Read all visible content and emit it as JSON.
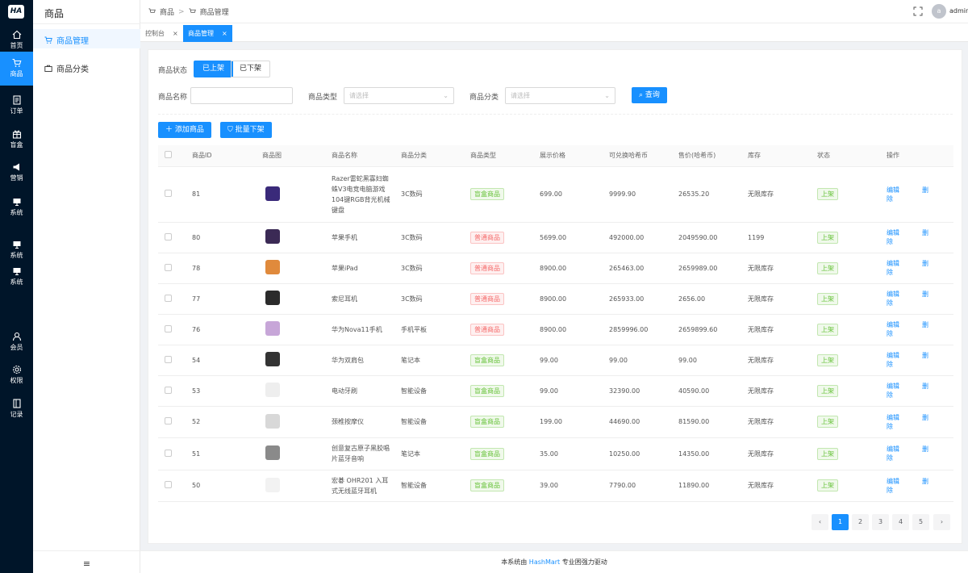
{
  "app": {
    "logo_text": "HA"
  },
  "rail": [
    {
      "label": "首页",
      "icon": "home-icon"
    },
    {
      "label": "商品",
      "icon": "cart-icon",
      "active": true
    },
    {
      "label": "订单",
      "icon": "document-icon"
    },
    {
      "label": "盲盒",
      "icon": "gift-icon"
    },
    {
      "label": "营销",
      "icon": "megaphone-icon"
    },
    {
      "label": "系统",
      "icon": "monitor-icon"
    },
    {
      "label": "系统",
      "icon": "monitor-icon"
    },
    {
      "label": "系统",
      "icon": "monitor-icon"
    },
    {
      "label": "会员",
      "icon": "user-icon"
    },
    {
      "label": "权限",
      "icon": "settings-icon"
    },
    {
      "label": "记录",
      "icon": "record-icon"
    }
  ],
  "sidebar": {
    "title": "商品",
    "items": [
      {
        "label": "商品管理",
        "icon": "cart-icon",
        "active": true
      },
      {
        "label": "商品分类",
        "icon": "briefcase-icon"
      }
    ],
    "collapse_glyph": "≡"
  },
  "header": {
    "breadcrumb": [
      "商品",
      "商品管理"
    ],
    "user": {
      "avatar_letter": "a",
      "name": "admin"
    }
  },
  "tabs": [
    {
      "label": "控制台",
      "close": "×"
    },
    {
      "label": "商品管理",
      "close": "×",
      "active": true
    }
  ],
  "filters": {
    "status_label": "商品状态",
    "status_options": [
      "已上架",
      "已下架"
    ],
    "name_label": "商品名称",
    "type_label": "商品类型",
    "type_placeholder": "请选择",
    "category_label": "商品分类",
    "category_placeholder": "请选择",
    "query_button": "查询"
  },
  "actions": {
    "add": "添加商品",
    "batch_off": "批量下架"
  },
  "table": {
    "headers": [
      "商品ID",
      "商品图",
      "商品名称",
      "商品分类",
      "商品类型",
      "展示价格",
      "可兑换哈希币",
      "售价(哈希币)",
      "库存",
      "状态",
      "操作"
    ],
    "edit_label": "编辑",
    "delete_label": "删除",
    "rows": [
      {
        "id": "81",
        "name": "Razer雷蛇黑寡妇蜘蛛V3电竞电脑游戏104键RGB背光机械键盘",
        "category": "3C数码",
        "type": "盲盒商品",
        "type_kind": "blind",
        "price": "699.00",
        "coins": "9999.90",
        "sale": "26535.20",
        "stock": "无限库存",
        "status": "上架",
        "img_color": "#3a2a7a"
      },
      {
        "id": "80",
        "name": "苹果手机",
        "category": "3C数码",
        "type": "普通商品",
        "type_kind": "normal",
        "price": "5699.00",
        "coins": "492000.00",
        "sale": "2049590.00",
        "stock": "1199",
        "status": "上架",
        "img_color": "#3b2a55"
      },
      {
        "id": "78",
        "name": "苹果iPad",
        "category": "3C数码",
        "type": "普通商品",
        "type_kind": "normal",
        "price": "8900.00",
        "coins": "265463.00",
        "sale": "2659989.00",
        "stock": "无限库存",
        "status": "上架",
        "img_color": "#e08a3c"
      },
      {
        "id": "77",
        "name": "索尼耳机",
        "category": "3C数码",
        "type": "普通商品",
        "type_kind": "normal",
        "price": "8900.00",
        "coins": "265933.00",
        "sale": "2656.00",
        "stock": "无限库存",
        "status": "上架",
        "img_color": "#2b2b2b"
      },
      {
        "id": "76",
        "name": "华为Nova11手机",
        "category": "手机平板",
        "type": "普通商品",
        "type_kind": "normal",
        "price": "8900.00",
        "coins": "2859996.00",
        "sale": "2659899.60",
        "stock": "无限库存",
        "status": "上架",
        "img_color": "#c7a6d8"
      },
      {
        "id": "54",
        "name": "华为双肩包",
        "category": "笔记本",
        "type": "盲盒商品",
        "type_kind": "blind",
        "price": "99.00",
        "coins": "99.00",
        "sale": "99.00",
        "stock": "无限库存",
        "status": "上架",
        "img_color": "#333333"
      },
      {
        "id": "53",
        "name": "电动牙刷",
        "category": "智能设备",
        "type": "盲盒商品",
        "type_kind": "blind",
        "price": "99.00",
        "coins": "32390.00",
        "sale": "40590.00",
        "stock": "无限库存",
        "status": "上架",
        "img_color": "#eeeeee"
      },
      {
        "id": "52",
        "name": "颈椎按摩仪",
        "category": "智能设备",
        "type": "盲盒商品",
        "type_kind": "blind",
        "price": "199.00",
        "coins": "44690.00",
        "sale": "81590.00",
        "stock": "无限库存",
        "status": "上架",
        "img_color": "#d8d8d8"
      },
      {
        "id": "51",
        "name": "创意复古原子黑胶唱片蓝牙音响",
        "category": "笔记本",
        "type": "盲盒商品",
        "type_kind": "blind",
        "price": "35.00",
        "coins": "10250.00",
        "sale": "14350.00",
        "stock": "无限库存",
        "status": "上架",
        "img_color": "#8a8a8a"
      },
      {
        "id": "50",
        "name": "宏碁 OHR201 入耳式无线蓝牙耳机",
        "category": "智能设备",
        "type": "盲盒商品",
        "type_kind": "blind",
        "price": "39.00",
        "coins": "7790.00",
        "sale": "11890.00",
        "stock": "无限库存",
        "status": "上架",
        "img_color": "#f2f2f2"
      }
    ]
  },
  "pagination": {
    "pages": [
      "1",
      "2",
      "3",
      "4",
      "5"
    ],
    "current": "1",
    "prev": "‹",
    "next": "›"
  },
  "footer": {
    "prefix": "本系统由",
    "brand": "HashMart",
    "suffix": "专业困强力驱动"
  }
}
